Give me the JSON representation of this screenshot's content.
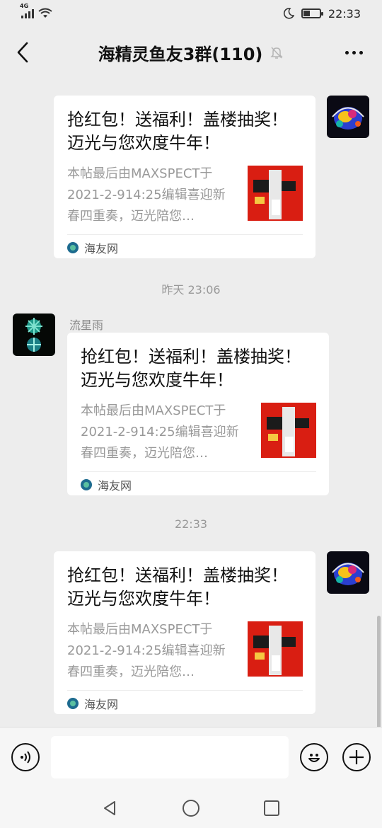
{
  "status_bar": {
    "network": "4G",
    "time": "22:33"
  },
  "nav": {
    "title": "海精灵鱼友3群(110)"
  },
  "messages": [
    {
      "title": "抢红包！送福利！盖楼抽奖！迈光与您欢度牛年！",
      "desc": "本帖最后由MAXSPECT于2021-2-914:25编辑喜迎新春四重奏，迈光陪您…",
      "source": "海友网"
    },
    {
      "sender": "流星雨",
      "title": "抢红包！送福利！盖楼抽奖！迈光与您欢度牛年！",
      "desc": "本帖最后由MAXSPECT于2021-2-914:25编辑喜迎新春四重奏，迈光陪您…",
      "source": "海友网"
    },
    {
      "title": "抢红包！送福利！盖楼抽奖！迈光与您欢度牛年！",
      "desc": "本帖最后由MAXSPECT于2021-2-914:25编辑喜迎新春四重奏，迈光陪您…",
      "source": "海友网"
    }
  ],
  "timestamps": [
    "昨天 23:06",
    "22:33"
  ],
  "input": {
    "value": ""
  },
  "icons": {
    "back": "back-arrow-icon",
    "mute": "bell-off-icon",
    "more": "more-dots-icon",
    "voice": "voice-icon",
    "emoji": "emoji-icon",
    "plus": "plus-icon"
  }
}
